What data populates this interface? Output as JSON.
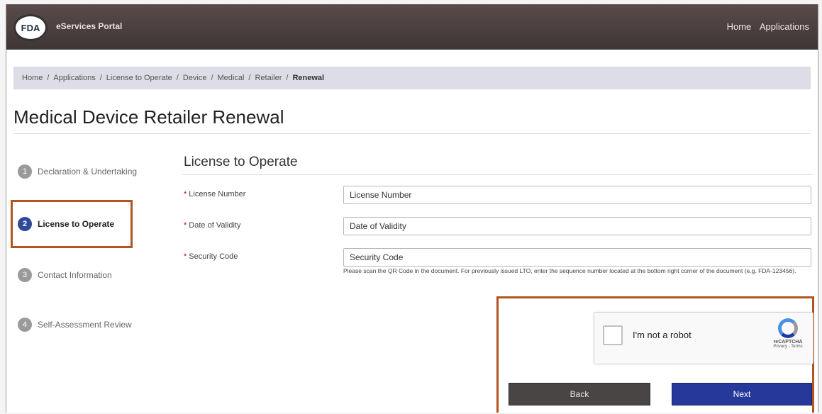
{
  "header": {
    "logo_text": "FDA",
    "portal_name": "eServices Portal",
    "nav": [
      "Home",
      "Applications"
    ]
  },
  "breadcrumb": [
    "Home",
    "Applications",
    "License to Operate",
    "Device",
    "Medical",
    "Retailer",
    "Renewal"
  ],
  "page_title": "Medical Device Retailer Renewal",
  "steps": [
    {
      "number": "1",
      "label": "Declaration & Undertaking",
      "active": false
    },
    {
      "number": "2",
      "label": "License to Operate",
      "active": true
    },
    {
      "number": "3",
      "label": "Contact Information",
      "active": false
    },
    {
      "number": "4",
      "label": "Self-Assessment Review",
      "active": false
    }
  ],
  "form": {
    "section_title": "License to Operate",
    "required_mark": "*",
    "fields": [
      {
        "label": "License Number",
        "placeholder": "License Number",
        "value": ""
      },
      {
        "label": "Date of Validity",
        "placeholder": "Date of Validity",
        "value": ""
      },
      {
        "label": "Security Code",
        "placeholder": "Security Code",
        "value": ""
      }
    ],
    "help_text": "Please scan the QR Code in the document. For previously issued LTO, enter the sequence number located at the bottom right corner of the document (e.g. FDA-123456)."
  },
  "recaptcha": {
    "label": "I'm not a robot",
    "brand": "reCAPTCHA",
    "terms": "Privacy - Terms",
    "checked": false
  },
  "buttons": {
    "back": "Back",
    "next": "Next"
  },
  "colors": {
    "header_bg": "#4a3f3f",
    "active_step": "#2f4a9b",
    "highlight_border": "#b2551f",
    "next_button": "#26399a",
    "back_button": "#4a4545"
  }
}
